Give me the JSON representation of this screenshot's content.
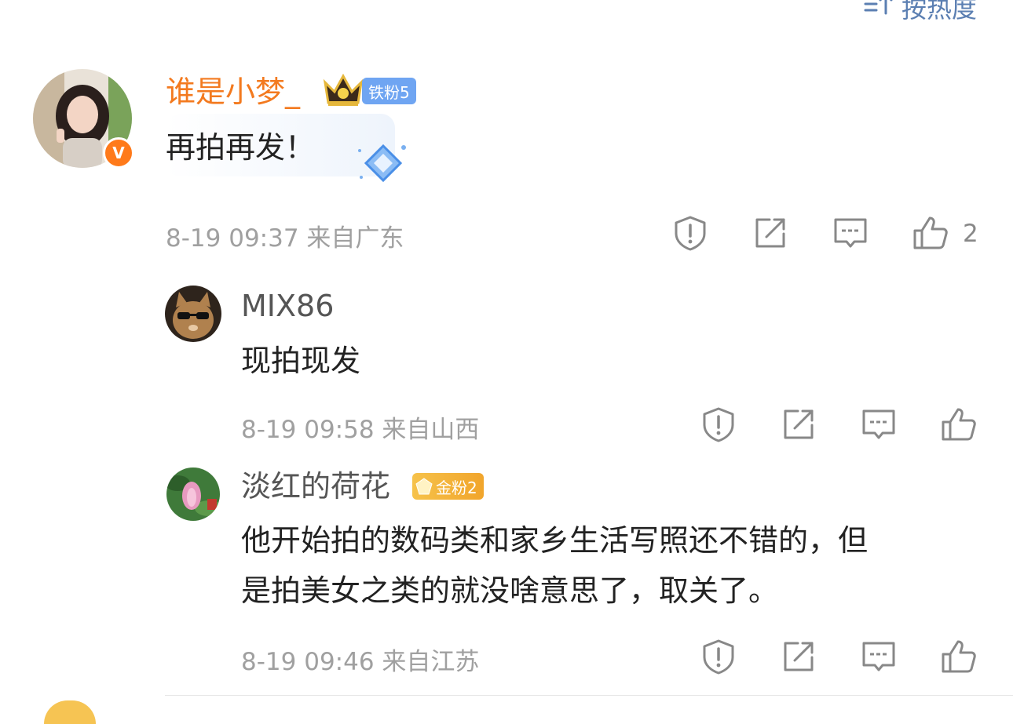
{
  "header": {
    "sort_label": "按热度"
  },
  "comments": [
    {
      "username": "谁是小梦_",
      "fan_badge": "铁粉5",
      "text": "再拍再发！",
      "date": "8-19",
      "time": "09:37",
      "location": "来自广东",
      "likes": "2"
    },
    {
      "username": "MIX86",
      "text": "现拍现发",
      "date": "8-19",
      "time": "09:58",
      "location": "来自山西"
    },
    {
      "username": "淡红的荷花",
      "fan_badge": "金粉2",
      "text_line1": "他开始拍的数码类和家乡生活写照还不错的，但",
      "text_line2": "是拍美女之类的就没啥意思了，取关了。",
      "date": "8-19",
      "time": "09:46",
      "location": "来自江苏"
    }
  ],
  "colors": {
    "accent_orange": "#f37a1f",
    "link_blue": "#5b7fb2",
    "meta_gray": "#a0a0a0"
  },
  "icons": [
    "sort-icon",
    "report-icon",
    "share-icon",
    "reply-icon",
    "like-icon",
    "verified-v-icon",
    "crown-icon",
    "diamond-sticker-icon"
  ]
}
